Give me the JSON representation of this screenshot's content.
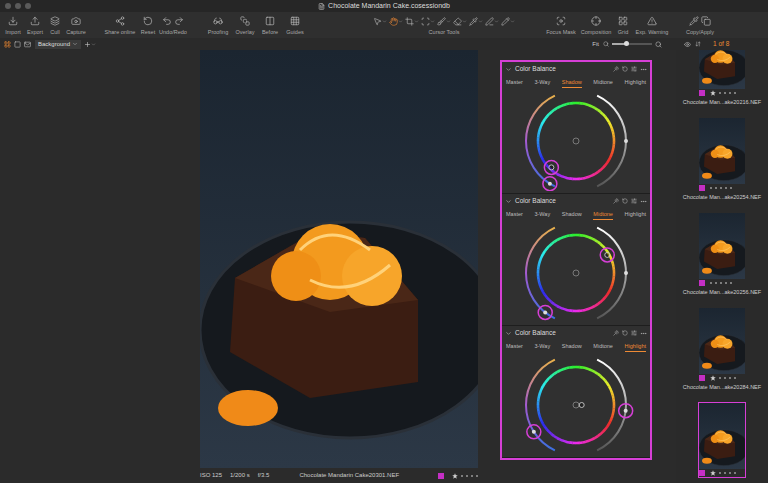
{
  "window": {
    "title": "Chocolate Mandarin Cake.cosessiondb"
  },
  "toolbar": [
    {
      "label": "Import",
      "kind": "button"
    },
    {
      "label": "Export",
      "kind": "button"
    },
    {
      "label": "Cull",
      "kind": "button"
    },
    {
      "label": "Capture",
      "kind": "button"
    },
    {
      "label": "Share online",
      "kind": "button"
    },
    {
      "label": "Reset",
      "kind": "button"
    },
    {
      "label": "Undo/Redo",
      "kind": "button"
    },
    {
      "label": "Proofing",
      "kind": "button"
    },
    {
      "label": "Overlay",
      "kind": "button"
    },
    {
      "label": "Before",
      "kind": "button"
    },
    {
      "label": "Guides",
      "kind": "button"
    },
    {
      "label": "Cursor Tools",
      "kind": "cursor-tools"
    },
    {
      "label": "Focus Mask",
      "kind": "button"
    },
    {
      "label": "Composition",
      "kind": "button"
    },
    {
      "label": "Grid",
      "kind": "button"
    },
    {
      "label": "Exp. Warning",
      "kind": "button"
    },
    {
      "label": "Copy/Apply",
      "kind": "button"
    }
  ],
  "cursor_tools": [
    {
      "selected": false
    },
    {
      "selected": true
    },
    {
      "selected": false
    },
    {
      "selected": false
    },
    {
      "selected": false
    },
    {
      "selected": false
    },
    {
      "selected": false
    },
    {
      "selected": false
    },
    {
      "selected": false
    }
  ],
  "viewer_bar": {
    "view_modes": [
      {
        "selected": true
      },
      {
        "selected": false
      },
      {
        "selected": false
      }
    ],
    "layer": "Background",
    "zoom": "Fit",
    "zoom_level": 0.35
  },
  "viewer": {
    "status": {
      "iso": "ISO 125",
      "shutter": "1/200 s",
      "aperture": "f/3.5",
      "file": "Chocolate Mandarin Cake20301.NEF",
      "color": "#c42fc4",
      "stars": 1
    }
  },
  "tools": [
    {
      "title": "Color Balance",
      "tabs": [
        {
          "label": "Master",
          "selected": false
        },
        {
          "label": "3-Way",
          "selected": false
        },
        {
          "label": "Shadow",
          "selected": true
        },
        {
          "label": "Midtone",
          "selected": false
        },
        {
          "label": "Highlight",
          "selected": false
        }
      ],
      "balance": {
        "hue": 223,
        "amount": 0.95
      },
      "left_level": 0.05,
      "right_level": 0.5,
      "marked": [
        "left-slider",
        "point"
      ]
    },
    {
      "title": "Color Balance",
      "tabs": [
        {
          "label": "Master",
          "selected": false
        },
        {
          "label": "3-Way",
          "selected": false
        },
        {
          "label": "Shadow",
          "selected": false
        },
        {
          "label": "Midtone",
          "selected": true
        },
        {
          "label": "Highlight",
          "selected": false
        }
      ],
      "balance": {
        "hue": 60,
        "amount": 0.95
      },
      "left_level": 0.1,
      "right_level": 0.5,
      "marked": [
        "point",
        "left-slider"
      ]
    },
    {
      "title": "Color Balance",
      "tabs": [
        {
          "label": "Master",
          "selected": false
        },
        {
          "label": "3-Way",
          "selected": false
        },
        {
          "label": "Shadow",
          "selected": false
        },
        {
          "label": "Midtone",
          "selected": false
        },
        {
          "label": "Highlight",
          "selected": true
        }
      ],
      "balance": {
        "hue": 90,
        "amount": 0.15
      },
      "left_level": 0.25,
      "right_level": 0.45,
      "marked": [
        "left-slider",
        "right-slider"
      ]
    }
  ],
  "browser": {
    "counter": "1 of 8",
    "items": [
      {
        "label": "Chocolate Man...ake20216.NEF",
        "color": "#c42fc4",
        "stars": 1,
        "selected": false
      },
      {
        "label": "Chocolate Man...ake20254.NEF",
        "color": "#c42fc4",
        "stars": 0,
        "selected": false
      },
      {
        "label": "Chocolate Man...ake20256.NEF",
        "color": "#c42fc4",
        "stars": 0,
        "selected": false
      },
      {
        "label": "Chocolate Man...ake20284.NEF",
        "color": "#c42fc4",
        "stars": 1,
        "selected": false
      },
      {
        "color": "#c42fc4",
        "stars": 1,
        "selected": true
      }
    ]
  }
}
